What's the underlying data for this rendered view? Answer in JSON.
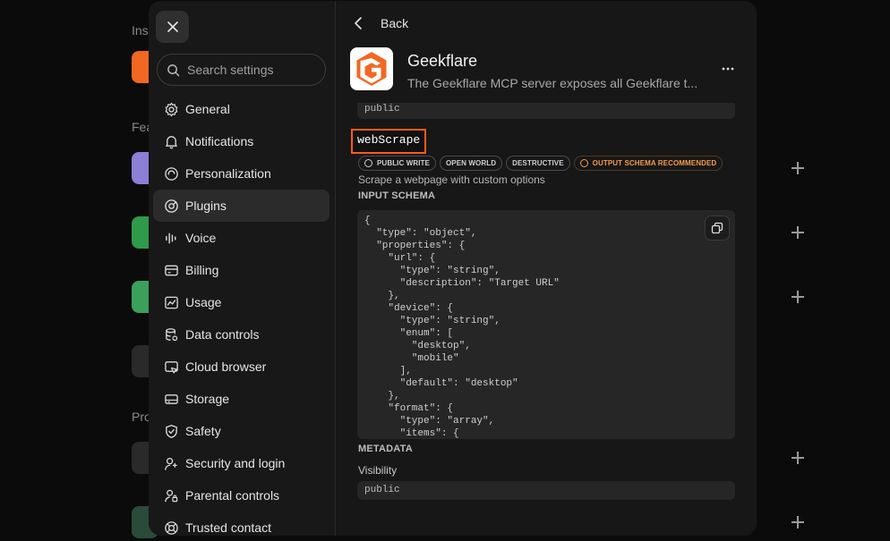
{
  "background": {
    "sections": [
      "Ins",
      "Fea",
      "Pro"
    ]
  },
  "sidebar": {
    "search_placeholder": "Search settings",
    "items": [
      {
        "label": "General",
        "icon": "gear-icon"
      },
      {
        "label": "Notifications",
        "icon": "bell-icon"
      },
      {
        "label": "Personalization",
        "icon": "personalization-icon"
      },
      {
        "label": "Plugins",
        "icon": "plugins-icon",
        "active": true
      },
      {
        "label": "Voice",
        "icon": "voice-icon"
      },
      {
        "label": "Billing",
        "icon": "card-icon"
      },
      {
        "label": "Usage",
        "icon": "chart-icon"
      },
      {
        "label": "Data controls",
        "icon": "database-icon"
      },
      {
        "label": "Cloud browser",
        "icon": "browser-icon"
      },
      {
        "label": "Storage",
        "icon": "storage-icon"
      },
      {
        "label": "Safety",
        "icon": "shield-icon"
      },
      {
        "label": "Security and login",
        "icon": "security-icon"
      },
      {
        "label": "Parental controls",
        "icon": "parental-icon"
      },
      {
        "label": "Trusted contact",
        "icon": "lifebuoy-icon"
      }
    ]
  },
  "main": {
    "back_label": "Back",
    "plugin": {
      "name": "Geekflare",
      "description": "The Geekflare MCP server exposes all Geekflare t..."
    },
    "previous_code": "public",
    "tool": {
      "name": "webScrape",
      "badges": [
        {
          "label": "PUBLIC WRITE",
          "icon": true,
          "warn": false
        },
        {
          "label": "OPEN WORLD",
          "icon": false,
          "warn": false
        },
        {
          "label": "DESTRUCTIVE",
          "icon": false,
          "warn": false
        },
        {
          "label": "OUTPUT SCHEMA RECOMMENDED",
          "icon": true,
          "warn": true
        }
      ],
      "description": "Scrape a webpage with custom options",
      "input_schema_label": "INPUT SCHEMA",
      "input_schema": "{\n  \"type\": \"object\",\n  \"properties\": {\n    \"url\": {\n      \"type\": \"string\",\n      \"description\": \"Target URL\"\n    },\n    \"device\": {\n      \"type\": \"string\",\n      \"enum\": [\n        \"desktop\",\n        \"mobile\"\n      ],\n      \"default\": \"desktop\"\n    },\n    \"format\": {\n      \"type\": \"array\",\n      \"items\": {",
      "metadata_label": "METADATA",
      "visibility_label": "Visibility",
      "visibility_value": "public"
    }
  },
  "colors": {
    "highlight": "#ff5a1a",
    "warn": "#f59a4a",
    "brand": "#f26722"
  }
}
